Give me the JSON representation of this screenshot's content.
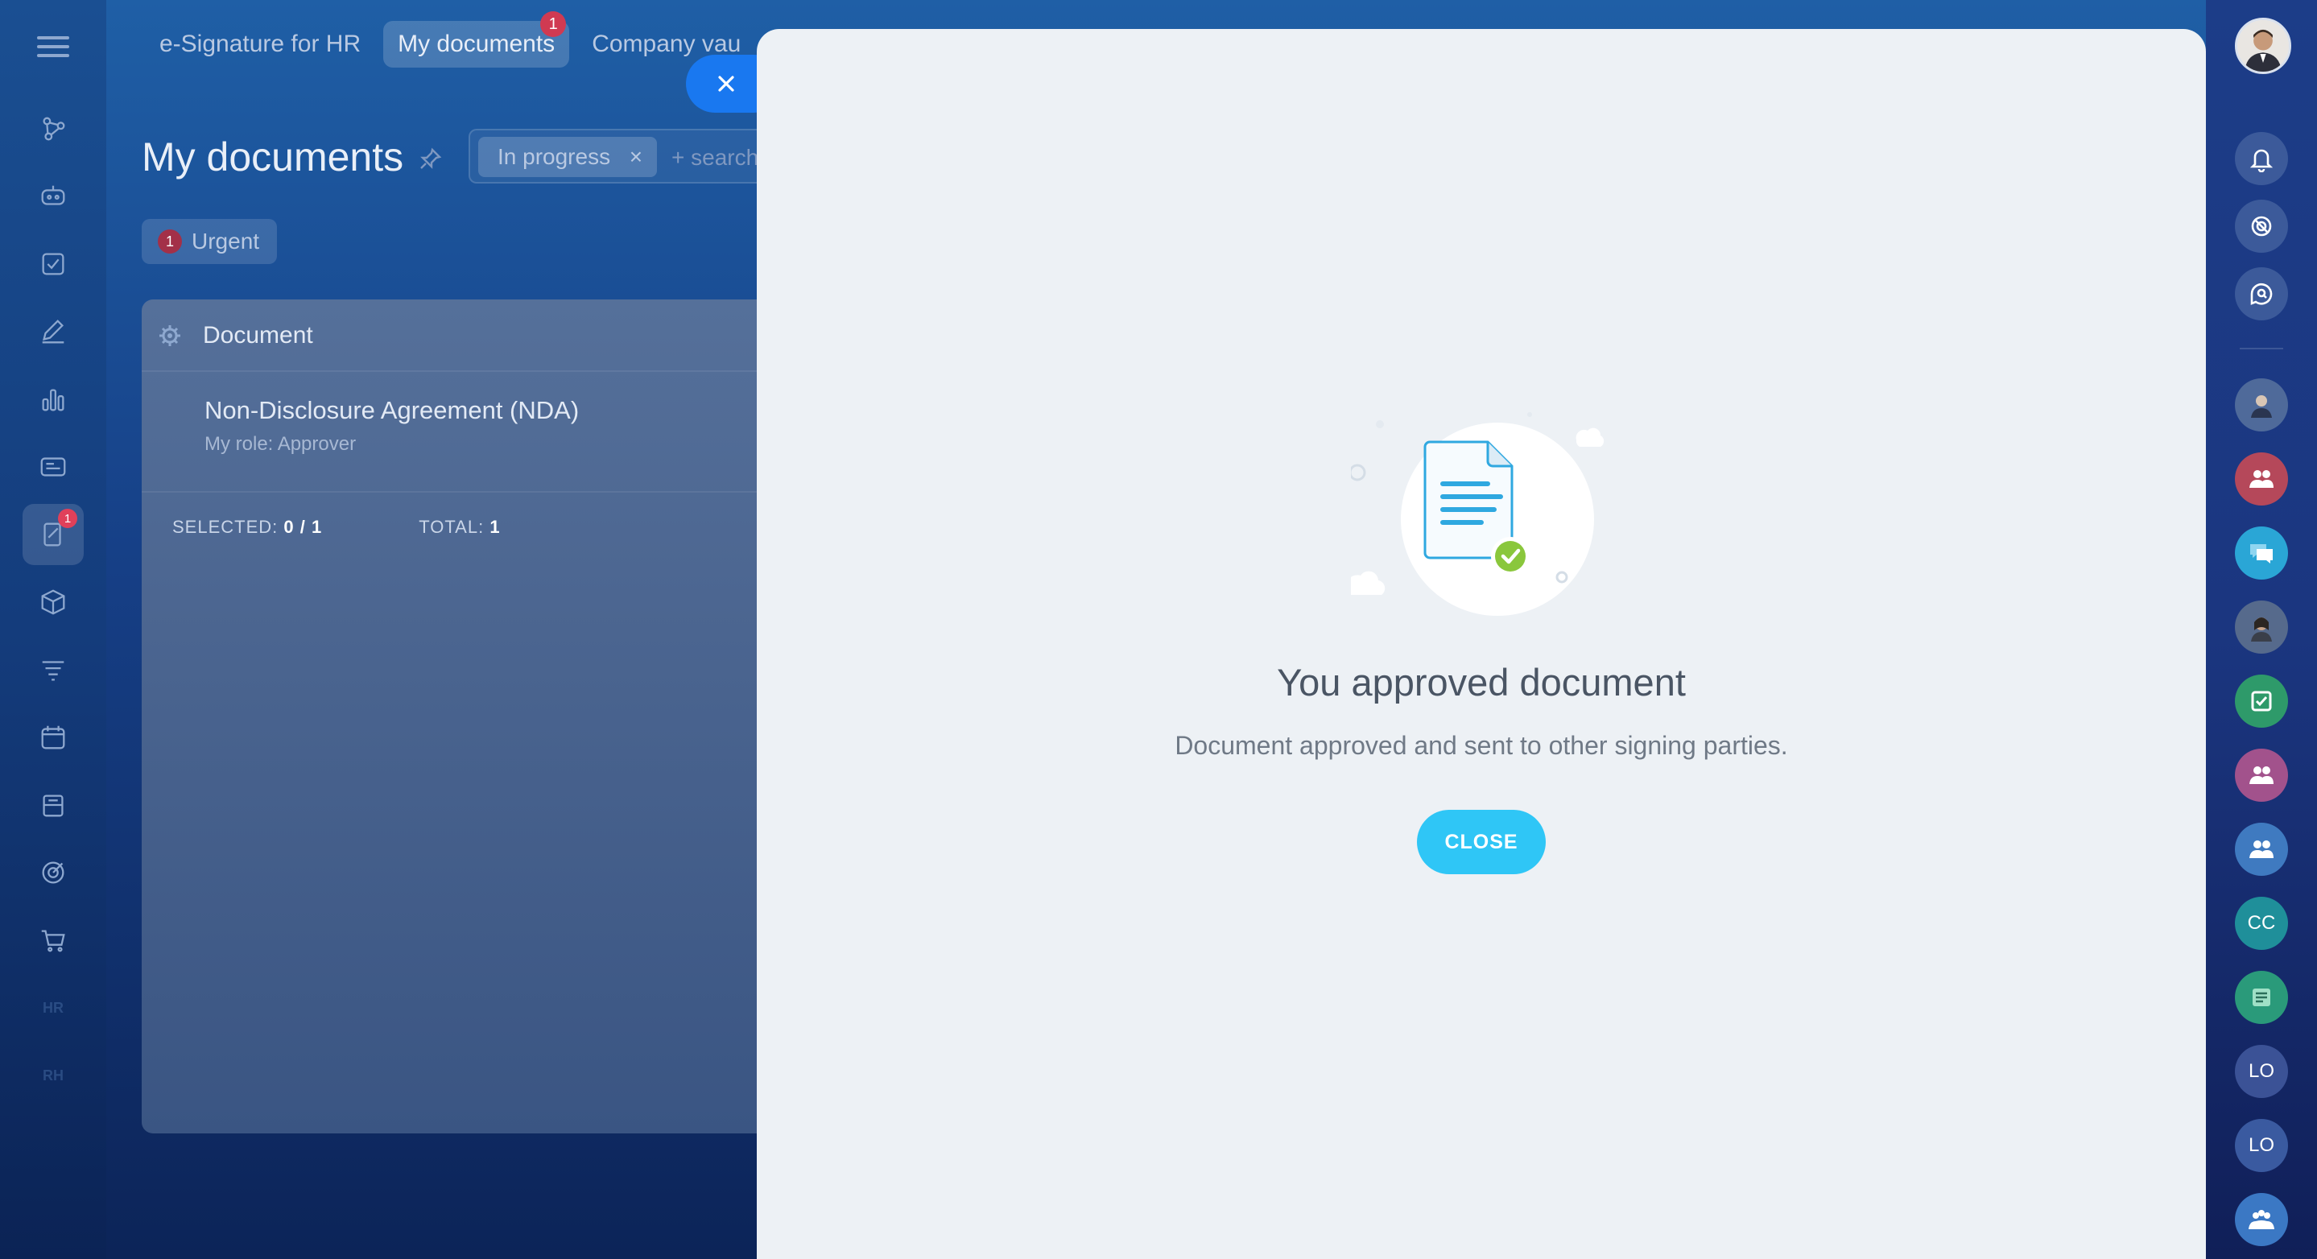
{
  "topbar": {
    "tabs": [
      {
        "label": "e-Signature for HR"
      },
      {
        "label": "My documents",
        "badge": "1"
      },
      {
        "label": "Company vau"
      }
    ]
  },
  "page": {
    "title": "My documents",
    "filter": {
      "chip_label": "In progress",
      "chip_remove": "×",
      "search_placeholder": "+ search"
    },
    "urgent": {
      "count": "1",
      "label": "Urgent"
    }
  },
  "left_rail": {
    "badge": "1",
    "text_items": [
      "HR",
      "RH"
    ]
  },
  "table": {
    "column_header": "Document",
    "rows": [
      {
        "title": "Non-Disclosure Agreement (NDA)",
        "role": "My role: Approver"
      }
    ],
    "footer": {
      "selected_label": "SELECTED:",
      "selected_value": "0 / 1",
      "total_label": "TOTAL:",
      "total_value": "1"
    }
  },
  "result": {
    "title": "You approved document",
    "text": "Document approved and sent to other signing parties.",
    "close_label": "CLOSE"
  },
  "right_rail": {
    "chats": [
      {
        "initials": "CC",
        "color": "#1f8f9a"
      },
      {
        "initials": "LO",
        "color": "#3b5296"
      },
      {
        "initials": "LO",
        "color": "#3a5aa0"
      }
    ]
  },
  "colors": {
    "accent": "#2fc6f6",
    "badge": "#d03a52",
    "success": "#8ac73c",
    "slider_close": "#1978f0"
  }
}
